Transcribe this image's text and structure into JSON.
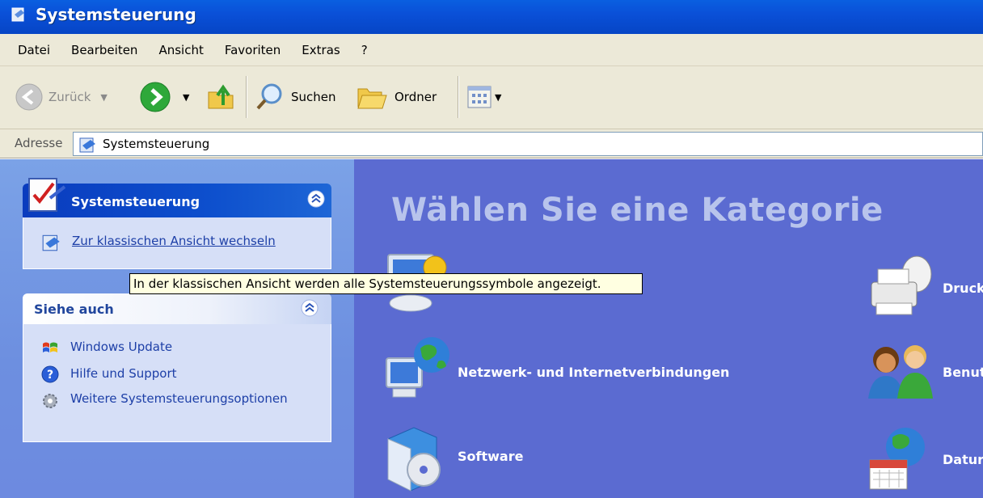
{
  "window": {
    "title": "Systemsteuerung"
  },
  "menu": [
    "Datei",
    "Bearbeiten",
    "Ansicht",
    "Favoriten",
    "Extras",
    "?"
  ],
  "toolbar": {
    "back_label": "Zurück",
    "search_label": "Suchen",
    "folders_label": "Ordner"
  },
  "address": {
    "label": "Adresse",
    "value": "Systemsteuerung"
  },
  "sidebar": {
    "panel1": {
      "title": "Systemsteuerung",
      "link": "Zur klassischen Ansicht wechseln"
    },
    "panel2": {
      "title": "Siehe auch",
      "items": [
        {
          "label": "Windows Update",
          "icon": "windows-update-icon"
        },
        {
          "label": "Hilfe und Support",
          "icon": "help-icon"
        },
        {
          "label": "Weitere Systemsteuerungsoptionen",
          "icon": "gear-icon"
        }
      ]
    }
  },
  "main": {
    "heading": "Wählen Sie eine Kategorie",
    "categories": [
      {
        "label": "",
        "icon": "display-icon"
      },
      {
        "label": "Netzwerk- und Internetverbindungen",
        "icon": "network-icon"
      },
      {
        "label": "Software",
        "icon": "software-icon"
      },
      {
        "label": "Druck",
        "icon": "printer-icon"
      },
      {
        "label": "Benut",
        "icon": "users-icon"
      },
      {
        "label": "Datur",
        "icon": "date-icon"
      }
    ]
  },
  "tooltip": "In der klassischen Ansicht werden alle Systemsteuerungssymbole angezeigt.",
  "colors": {
    "titlebar": "#0a50d8",
    "main_bg": "#5b6bd1",
    "sidebar": "#7ba2e7",
    "link": "#1d3fa7"
  }
}
